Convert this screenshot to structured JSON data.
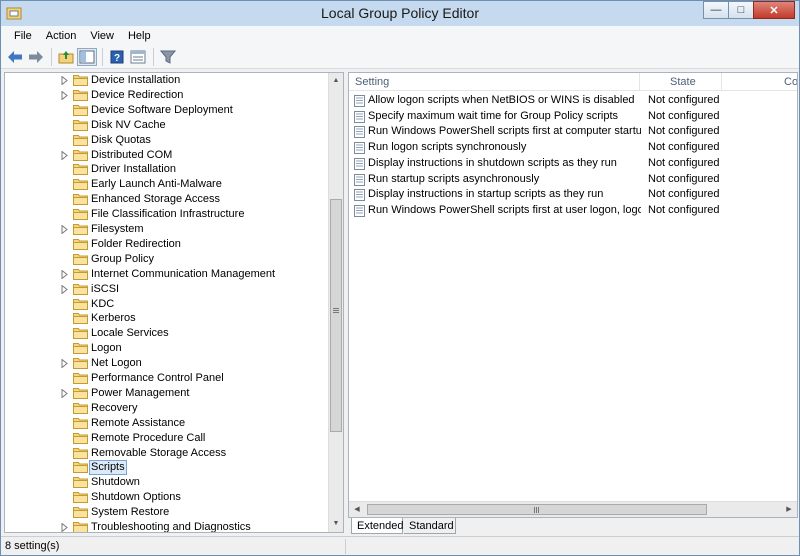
{
  "window": {
    "title": "Local Group Policy Editor"
  },
  "caption": {
    "minimize": "—",
    "maximize": "□",
    "close": "✕"
  },
  "menu": [
    "File",
    "Action",
    "View",
    "Help"
  ],
  "toolbar": [
    "back-icon",
    "forward-icon",
    "up-folder-icon",
    "show-hide-tree-icon",
    "export-list-icon",
    "help-icon",
    "properties-icon",
    "filter-icon"
  ],
  "tree": {
    "items": [
      {
        "label": "Device Installation",
        "expandable": true
      },
      {
        "label": "Device Redirection",
        "expandable": true
      },
      {
        "label": "Device Software Deployment",
        "expandable": false
      },
      {
        "label": "Disk NV Cache",
        "expandable": false
      },
      {
        "label": "Disk Quotas",
        "expandable": false
      },
      {
        "label": "Distributed COM",
        "expandable": true
      },
      {
        "label": "Driver Installation",
        "expandable": false
      },
      {
        "label": "Early Launch Anti-Malware",
        "expandable": false
      },
      {
        "label": "Enhanced Storage Access",
        "expandable": false
      },
      {
        "label": "File Classification Infrastructure",
        "expandable": false
      },
      {
        "label": "Filesystem",
        "expandable": true
      },
      {
        "label": "Folder Redirection",
        "expandable": false
      },
      {
        "label": "Group Policy",
        "expandable": false
      },
      {
        "label": "Internet Communication Management",
        "expandable": true
      },
      {
        "label": "iSCSI",
        "expandable": true
      },
      {
        "label": "KDC",
        "expandable": false
      },
      {
        "label": "Kerberos",
        "expandable": false
      },
      {
        "label": "Locale Services",
        "expandable": false
      },
      {
        "label": "Logon",
        "expandable": false
      },
      {
        "label": "Net Logon",
        "expandable": true
      },
      {
        "label": "Performance Control Panel",
        "expandable": false
      },
      {
        "label": "Power Management",
        "expandable": true
      },
      {
        "label": "Recovery",
        "expandable": false
      },
      {
        "label": "Remote Assistance",
        "expandable": false
      },
      {
        "label": "Remote Procedure Call",
        "expandable": false
      },
      {
        "label": "Removable Storage Access",
        "expandable": false
      },
      {
        "label": "Scripts",
        "expandable": false,
        "selected": true
      },
      {
        "label": "Shutdown",
        "expandable": false
      },
      {
        "label": "Shutdown Options",
        "expandable": false
      },
      {
        "label": "System Restore",
        "expandable": false
      },
      {
        "label": "Troubleshooting and Diagnostics",
        "expandable": true
      }
    ]
  },
  "list": {
    "columns": [
      "Setting",
      "State",
      "Co"
    ],
    "rows": [
      {
        "setting": "Allow logon scripts when NetBIOS or WINS is disabled",
        "state": "Not configured"
      },
      {
        "setting": "Specify maximum wait time for Group Policy scripts",
        "state": "Not configured"
      },
      {
        "setting": "Run Windows PowerShell scripts first at computer startup, s...",
        "state": "Not configured"
      },
      {
        "setting": "Run logon scripts synchronously",
        "state": "Not configured"
      },
      {
        "setting": "Display instructions in shutdown scripts as they run",
        "state": "Not configured"
      },
      {
        "setting": "Run startup scripts asynchronously",
        "state": "Not configured"
      },
      {
        "setting": "Display instructions in startup scripts as they run",
        "state": "Not configured"
      },
      {
        "setting": "Run Windows PowerShell scripts first at user logon, logoff",
        "state": "Not configured"
      }
    ]
  },
  "tabs": [
    "Extended",
    "Standard"
  ],
  "status": {
    "text": "8 setting(s)"
  }
}
